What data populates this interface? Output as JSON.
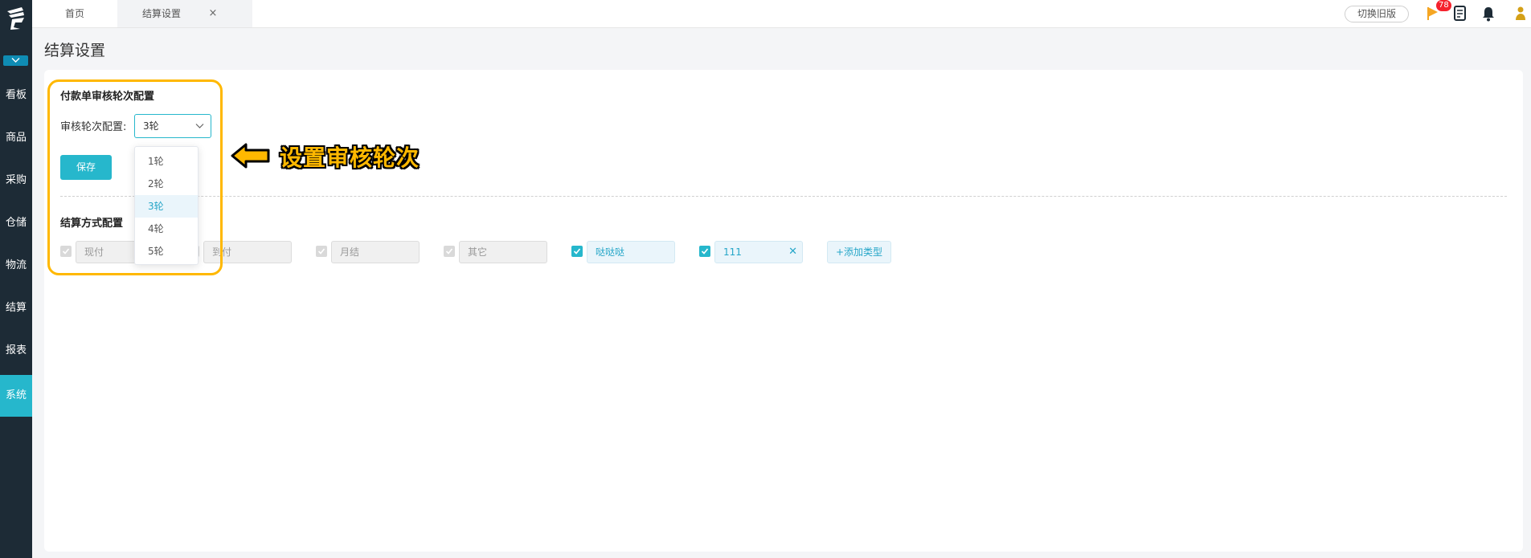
{
  "sidebar": {
    "items": [
      {
        "label": "看板"
      },
      {
        "label": "商品"
      },
      {
        "label": "采购"
      },
      {
        "label": "仓储"
      },
      {
        "label": "物流"
      },
      {
        "label": "结算"
      },
      {
        "label": "报表"
      },
      {
        "label": "系统",
        "active": true
      }
    ]
  },
  "tabs": {
    "home": "首页",
    "settings": "结算设置",
    "close": "×"
  },
  "header": {
    "switch_old": "切换旧版",
    "badge_count": "78",
    "icons": [
      "flag-icon",
      "notes-icon",
      "bell-icon",
      "user-icon"
    ]
  },
  "page": {
    "title": "结算设置"
  },
  "review": {
    "section_title": "付款单审核轮次配置",
    "label": "审核轮次配置:",
    "selected": "3轮",
    "options": [
      "1轮",
      "2轮",
      "3轮",
      "4轮",
      "5轮"
    ],
    "save": "保存"
  },
  "annotation": {
    "text": "设置审核轮次"
  },
  "payment": {
    "section_title": "结算方式配置",
    "items": [
      {
        "label": "现付",
        "checked": true,
        "enabled": false
      },
      {
        "label": "到付",
        "checked": true,
        "enabled": false
      },
      {
        "label": "月结",
        "checked": true,
        "enabled": false
      },
      {
        "label": "其它",
        "checked": true,
        "enabled": false
      },
      {
        "label": "哒哒哒",
        "checked": true,
        "enabled": true
      },
      {
        "label": "111",
        "checked": true,
        "enabled": true,
        "removable": true
      }
    ],
    "add_type": "+添加类型"
  },
  "colors": {
    "sidebar_bg": "#1d2b36",
    "accent": "#26b7cc",
    "highlight": "#ffb800",
    "badge": "#f5222d"
  }
}
